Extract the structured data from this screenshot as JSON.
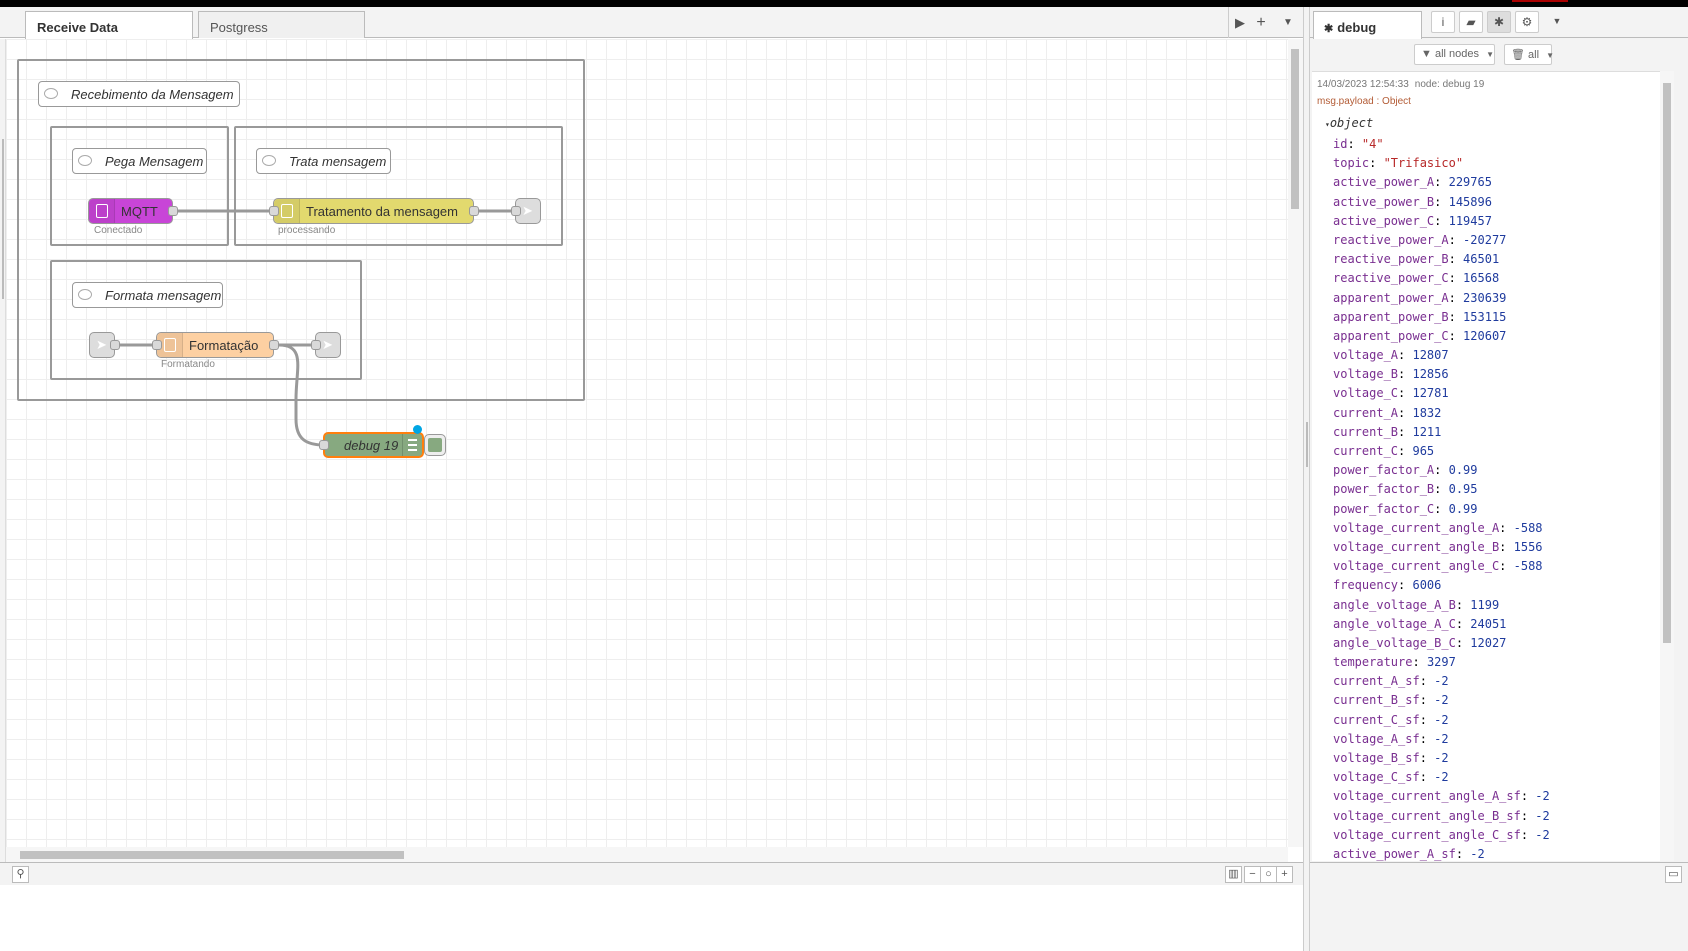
{
  "tabs": [
    {
      "label": "Receive Data",
      "active": true
    },
    {
      "label": "Postgress",
      "active": false
    }
  ],
  "groups": {
    "outer_comment": "Recebimento da Mensagem",
    "pega_comment": "Pega Mensagem",
    "trata_comment": "Trata mensagem",
    "formata_comment": "Formata mensagem"
  },
  "nodes": {
    "mqtt": {
      "label": "MQTT",
      "status": "Conectado",
      "color": "#c845d7"
    },
    "tratamento": {
      "label": "Tratamento da mensagem",
      "status": "processando",
      "color": "#e2d96e"
    },
    "formatacao": {
      "label": "Formatação",
      "status": "Formatando",
      "color": "#fdd0a2"
    },
    "debug": {
      "label": "debug 19",
      "color": "#87a980"
    }
  },
  "sidebar": {
    "tab_label": "debug",
    "filter_label": "all nodes",
    "clear_label": "all",
    "message": {
      "timestamp": "14/03/2023 12:54:33",
      "node": "node: debug 19",
      "topic": "msg.payload : Object",
      "object_label": "object",
      "props": [
        {
          "k": "id",
          "v": "\"4\"",
          "str": true
        },
        {
          "k": "topic",
          "v": "\"Trifasico\"",
          "str": true
        },
        {
          "k": "active_power_A",
          "v": "229765"
        },
        {
          "k": "active_power_B",
          "v": "145896"
        },
        {
          "k": "active_power_C",
          "v": "119457"
        },
        {
          "k": "reactive_power_A",
          "v": "-20277"
        },
        {
          "k": "reactive_power_B",
          "v": "46501"
        },
        {
          "k": "reactive_power_C",
          "v": "16568"
        },
        {
          "k": "apparent_power_A",
          "v": "230639"
        },
        {
          "k": "apparent_power_B",
          "v": "153115"
        },
        {
          "k": "apparent_power_C",
          "v": "120607"
        },
        {
          "k": "voltage_A",
          "v": "12807"
        },
        {
          "k": "voltage_B",
          "v": "12856"
        },
        {
          "k": "voltage_C",
          "v": "12781"
        },
        {
          "k": "current_A",
          "v": "1832"
        },
        {
          "k": "current_B",
          "v": "1211"
        },
        {
          "k": "current_C",
          "v": "965"
        },
        {
          "k": "power_factor_A",
          "v": "0.99"
        },
        {
          "k": "power_factor_B",
          "v": "0.95"
        },
        {
          "k": "power_factor_C",
          "v": "0.99"
        },
        {
          "k": "voltage_current_angle_A",
          "v": "-588"
        },
        {
          "k": "voltage_current_angle_B",
          "v": "1556"
        },
        {
          "k": "voltage_current_angle_C",
          "v": "-588"
        },
        {
          "k": "frequency",
          "v": "6006"
        },
        {
          "k": "angle_voltage_A_B",
          "v": "1199"
        },
        {
          "k": "angle_voltage_A_C",
          "v": "24051"
        },
        {
          "k": "angle_voltage_B_C",
          "v": "12027"
        },
        {
          "k": "temperature",
          "v": "3297"
        },
        {
          "k": "current_A_sf",
          "v": "-2"
        },
        {
          "k": "current_B_sf",
          "v": "-2"
        },
        {
          "k": "current_C_sf",
          "v": "-2"
        },
        {
          "k": "voltage_A_sf",
          "v": "-2"
        },
        {
          "k": "voltage_B_sf",
          "v": "-2"
        },
        {
          "k": "voltage_C_sf",
          "v": "-2"
        },
        {
          "k": "voltage_current_angle_A_sf",
          "v": "-2"
        },
        {
          "k": "voltage_current_angle_B_sf",
          "v": "-2"
        },
        {
          "k": "voltage_current_angle_C_sf",
          "v": "-2"
        },
        {
          "k": "active_power_A_sf",
          "v": "-2"
        }
      ]
    }
  },
  "icons": [
    "play-icon",
    "plus-icon",
    "chevron-down-icon",
    "bug-icon",
    "info-icon",
    "book-icon",
    "gear-icon",
    "filter-icon",
    "trash-icon",
    "search-icon",
    "map-icon",
    "zoom-out-icon",
    "zoom-reset-icon",
    "zoom-in-icon",
    "comment-icon",
    "link-icon",
    "function-icon",
    "list-icon"
  ]
}
